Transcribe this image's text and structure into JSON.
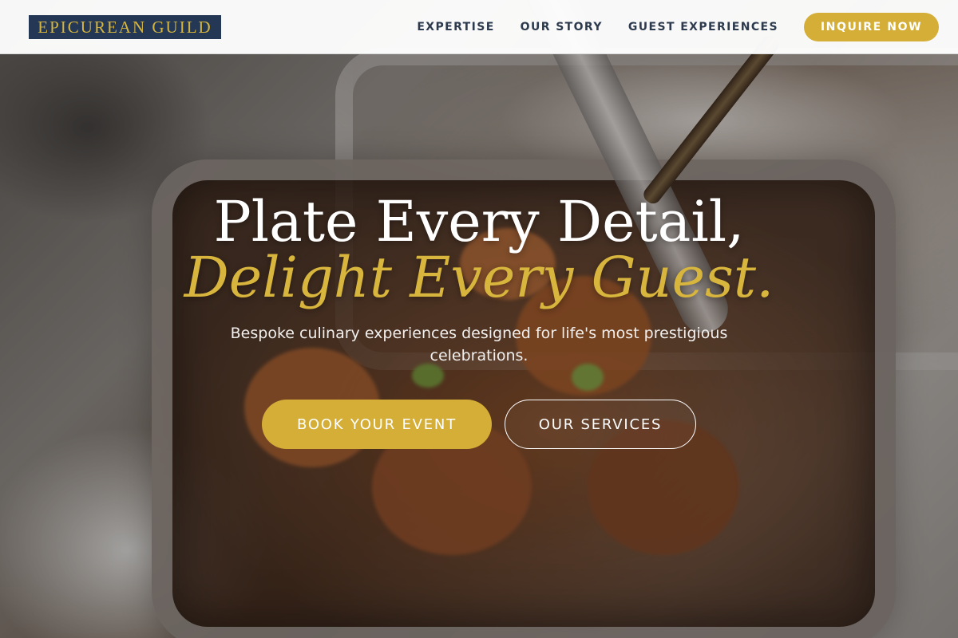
{
  "brand": {
    "name": "EPICUREAN GUILD"
  },
  "nav": {
    "items": [
      "EXPERTISE",
      "OUR STORY",
      "GUEST EXPERIENCES"
    ],
    "cta_label": "INQUIRE NOW"
  },
  "hero": {
    "headline_line1": "Plate Every Detail,",
    "headline_line2": "Delight Every Guest.",
    "subtitle": "Bespoke culinary experiences designed for life's most prestigious celebrations.",
    "primary_button": "BOOK YOUR EVENT",
    "secondary_button": "OUR SERVICES",
    "background_image": "food-tray-photo"
  },
  "colors": {
    "brand_navy": "#243856",
    "accent_gold": "#d4ae36",
    "nav_text": "#2d3a4d",
    "white": "#ffffff"
  }
}
